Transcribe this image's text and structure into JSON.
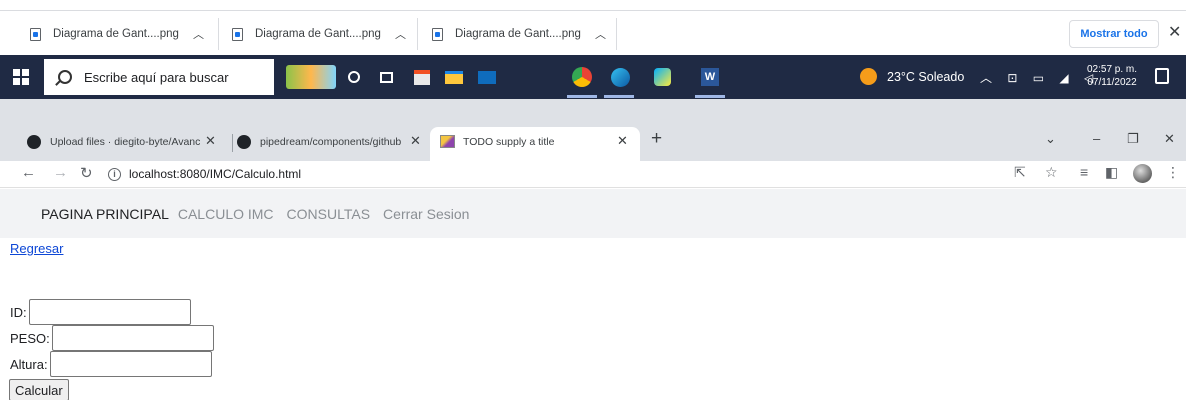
{
  "downloads": {
    "items": [
      {
        "name": "Diagrama de Gant....png"
      },
      {
        "name": "Diagrama de Gant....png"
      },
      {
        "name": "Diagrama de Gant....png"
      }
    ],
    "show_all": "Mostrar todo",
    "close": "✕"
  },
  "taskbar": {
    "search_placeholder": "Escribe aquí para buscar",
    "weather": "23°C  Soleado",
    "time": "02:57 p. m.",
    "date": "07/11/2022"
  },
  "browser": {
    "tabs": [
      {
        "title": "Upload files · diegito-byte/Avanc"
      },
      {
        "title": "pipedream/components/github"
      },
      {
        "title": "TODO supply a title"
      }
    ],
    "url": "localhost:8080/IMC/Calculo.html"
  },
  "page": {
    "nav": {
      "brand": "PAGINA PRINCIPAL",
      "links": [
        "CALCULO IMC",
        "CONSULTAS",
        "Cerrar Sesion"
      ]
    },
    "back_link": "Regresar",
    "form": {
      "id_label": "ID:",
      "peso_label": "PESO:",
      "altura_label": "Altura:",
      "id_value": "",
      "peso_value": "",
      "altura_value": "",
      "submit": "Calcular"
    }
  }
}
